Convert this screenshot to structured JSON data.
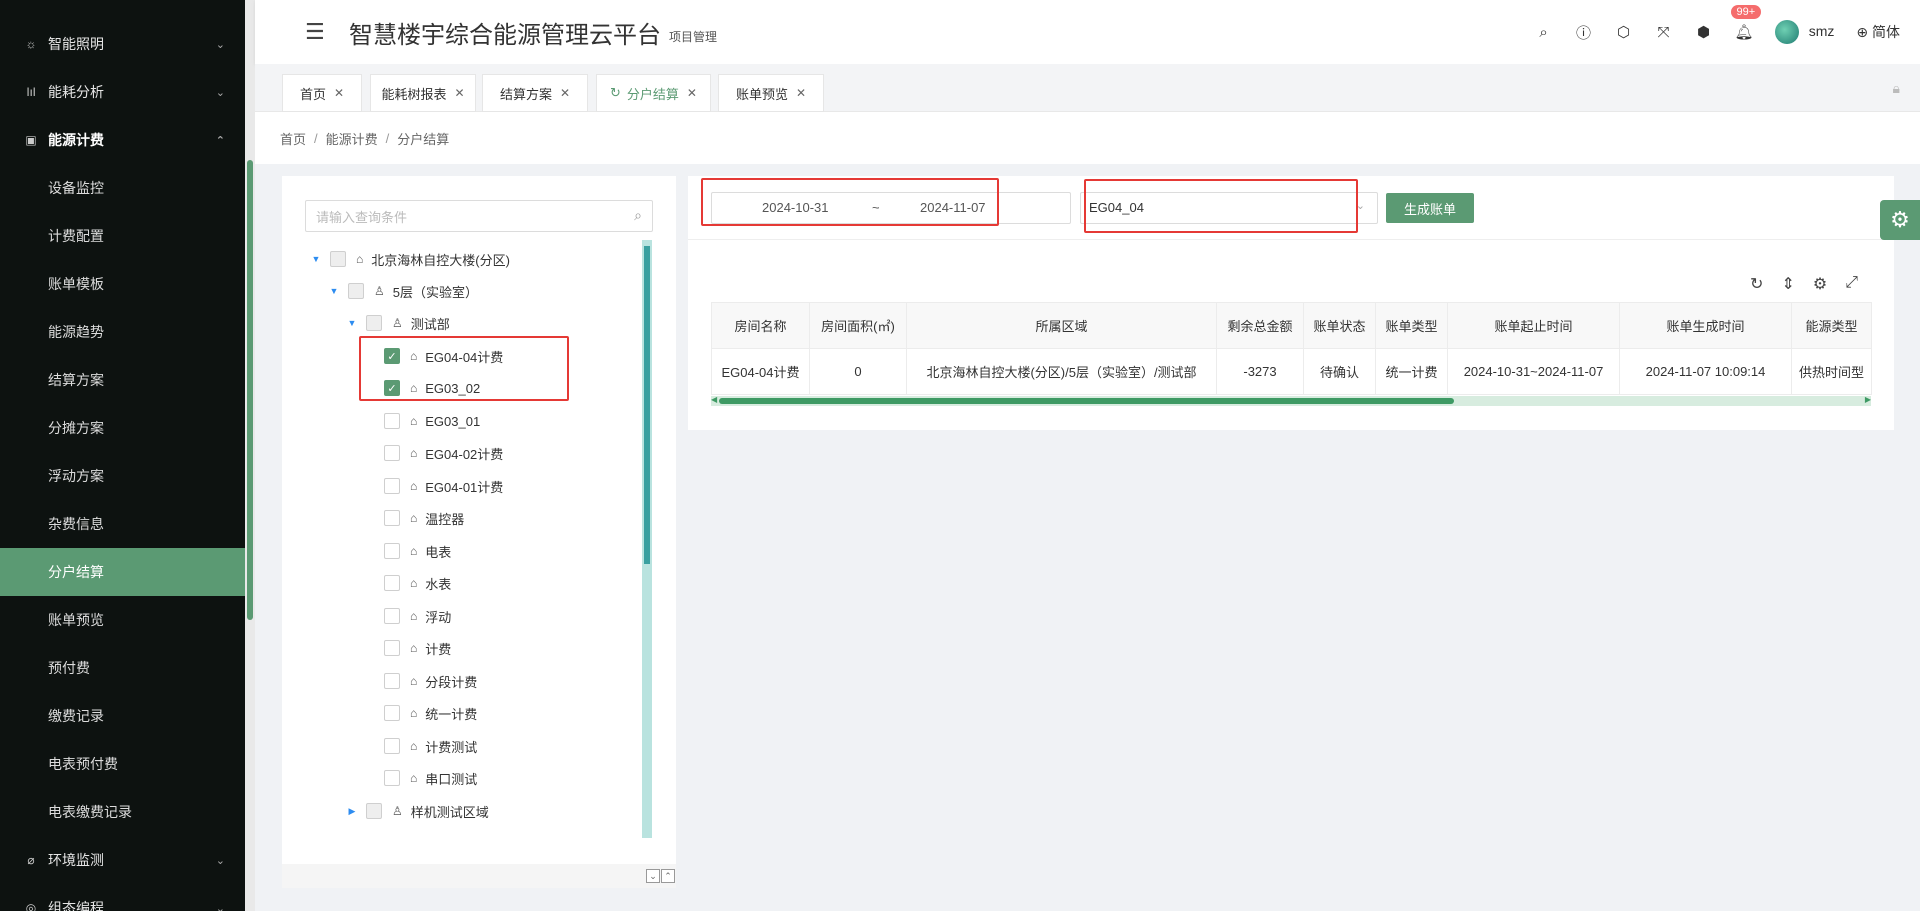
{
  "header": {
    "title": "智慧楼宇综合能源管理云平台",
    "subtitle": "项目管理",
    "badge": "99+",
    "user_name": "smz",
    "language": "简体"
  },
  "sidebar": {
    "groups": [
      {
        "label": "智能照明",
        "icon": "lightbulb-icon"
      },
      {
        "label": "能耗分析",
        "icon": "chart-icon"
      },
      {
        "label": "能源计费",
        "icon": "billing-icon",
        "open": true
      }
    ],
    "submenu": [
      "设备监控",
      "计费配置",
      "账单模板",
      "能源趋势",
      "结算方案",
      "分摊方案",
      "浮动方案",
      "杂费信息",
      "分户结算",
      "账单预览",
      "预付费",
      "缴费记录",
      "电表预付费",
      "电表缴费记录"
    ],
    "active_submenu": "分户结算",
    "bottom_groups": [
      {
        "label": "环境监测",
        "icon": "leaf-icon"
      },
      {
        "label": "组态编程",
        "icon": "config-icon"
      }
    ]
  },
  "tabs": [
    {
      "label": "首页"
    },
    {
      "label": "能耗树报表"
    },
    {
      "label": "结算方案"
    },
    {
      "label": "分户结算",
      "active": true
    },
    {
      "label": "账单预览"
    }
  ],
  "breadcrumb": [
    "首页",
    "能源计费",
    "分户结算"
  ],
  "tree": {
    "search_placeholder": "请输入查询条件",
    "nodes": [
      {
        "label": "北京海林自控大楼(分区)",
        "level": 0
      },
      {
        "label": "5层（实验室）",
        "level": 1
      },
      {
        "label": "测试部",
        "level": 2
      },
      {
        "label": "EG04-04计费",
        "level": 3,
        "checked": true
      },
      {
        "label": "EG03_02",
        "level": 3,
        "checked": true
      },
      {
        "label": "EG03_01",
        "level": 3
      },
      {
        "label": "EG04-02计费",
        "level": 3
      },
      {
        "label": "EG04-01计费",
        "level": 3
      },
      {
        "label": "温控器",
        "level": 3
      },
      {
        "label": "电表",
        "level": 3
      },
      {
        "label": "水表",
        "level": 3
      },
      {
        "label": "浮动",
        "level": 3
      },
      {
        "label": "计费",
        "level": 3
      },
      {
        "label": "分段计费",
        "level": 3
      },
      {
        "label": "统一计费",
        "level": 3
      },
      {
        "label": "计费测试",
        "level": 3
      },
      {
        "label": "串口测试",
        "level": 3
      },
      {
        "label": "样机测试区域",
        "level": 2
      }
    ]
  },
  "filter": {
    "start_date": "2024-10-31",
    "date_separator": "~",
    "end_date": "2024-11-07",
    "selected_scheme": "EG04_04",
    "generate_button": "生成账单"
  },
  "table": {
    "columns": [
      "房间名称",
      "房间面积(㎡)",
      "所属区域",
      "剩余总金额",
      "账单状态",
      "账单类型",
      "账单起止时间",
      "账单生成时间",
      "能源类型"
    ],
    "rows": [
      [
        "EG04-04计费",
        "0",
        "北京海林自控大楼(分区)/5层（实验室）/测试部",
        "-3273",
        "待确认",
        "统一计费",
        "2024-10-31~2024-11-07",
        "2024-11-07 10:09:14",
        "供热时间型"
      ]
    ]
  },
  "colors": {
    "accent": "#5b9a73",
    "sidebar_bg": "#0d1210",
    "highlight_red": "#e53935",
    "badge": "#f56c6c"
  }
}
